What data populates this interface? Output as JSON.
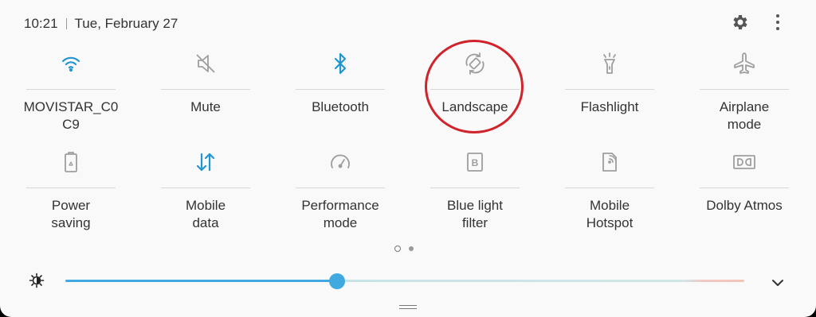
{
  "status": {
    "time": "10:21",
    "date": "Tue, February 27"
  },
  "header_icons": {
    "settings": "gear-icon",
    "menu": "more-vertical-icon"
  },
  "tiles": [
    {
      "label": "MOVISTAR_C0\nC9",
      "icon": "wifi-icon",
      "active": true
    },
    {
      "label": "Mute",
      "icon": "mute-icon",
      "active": false
    },
    {
      "label": "Bluetooth",
      "icon": "bluetooth-icon",
      "active": true
    },
    {
      "label": "Landscape",
      "icon": "rotate-icon",
      "active": false
    },
    {
      "label": "Flashlight",
      "icon": "flashlight-icon",
      "active": false
    },
    {
      "label": "Airplane\nmode",
      "icon": "airplane-icon",
      "active": false
    },
    {
      "label": "Power\nsaving",
      "icon": "battery-icon",
      "active": false
    },
    {
      "label": "Mobile\ndata",
      "icon": "mobile-data-icon",
      "active": true
    },
    {
      "label": "Performance\nmode",
      "icon": "gauge-icon",
      "active": false
    },
    {
      "label": "Blue light\nfilter",
      "icon": "blue-light-icon",
      "active": false
    },
    {
      "label": "Mobile\nHotspot",
      "icon": "hotspot-icon",
      "active": false
    },
    {
      "label": "Dolby Atmos",
      "icon": "dolby-icon",
      "active": false
    }
  ],
  "pager": {
    "current": 1,
    "total": 2
  },
  "brightness": {
    "level": 0.4
  },
  "colors": {
    "active": "#2196d3",
    "inactive": "#9e9e9e",
    "slider": "#40a9e0",
    "highlight": "#d0242c"
  }
}
